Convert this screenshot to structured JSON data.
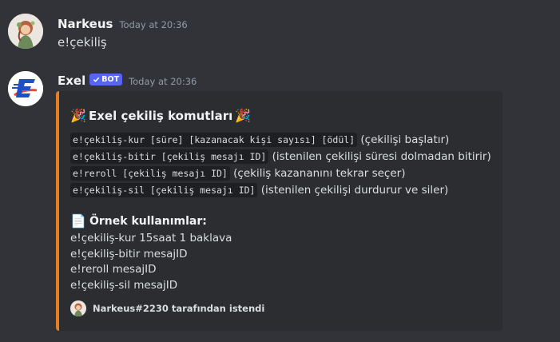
{
  "messages": [
    {
      "username": "Narkeus",
      "timestamp": "Today at 20:36",
      "content": "e!çekiliş"
    },
    {
      "username": "Exel",
      "bot_tag": "BOT",
      "timestamp": "Today at 20:36",
      "embed": {
        "accent_color": "#e67e22",
        "title": "Exel çekiliş komutları",
        "commands": [
          {
            "code": "e!çekiliş-kur [süre] [kazanacak kişi sayısı] [ödül]",
            "desc": " (çekilişi başlatır)"
          },
          {
            "code": "e!çekiliş-bitir [çekiliş mesajı ID]",
            "desc": " (istenilen çekilişi süresi dolmadan bitirir)"
          },
          {
            "code": "e!reroll [çekiliş mesajı ID]",
            "desc": " (çekiliş kazananını tekrar seçer)"
          },
          {
            "code": "e!çekiliş-sil [çekiliş mesajı ID]",
            "desc": " (istenilen çekilişi durdurur ve siler)"
          }
        ],
        "examples_title": "Örnek kullanımlar:",
        "examples": [
          "e!çekiliş-kur 15saat 1 baklava",
          "e!çekiliş-bitir mesajID",
          "e!reroll mesajID",
          "e!çekiliş-sil mesajID"
        ],
        "footer": "Narkeus#2230 tarafından istendi"
      }
    }
  ],
  "icons": {
    "title_left": "party-popper-icon",
    "title_right": "party-popper-icon",
    "examples": "page-facing-up-icon",
    "bot_check": "checkmark-icon"
  }
}
